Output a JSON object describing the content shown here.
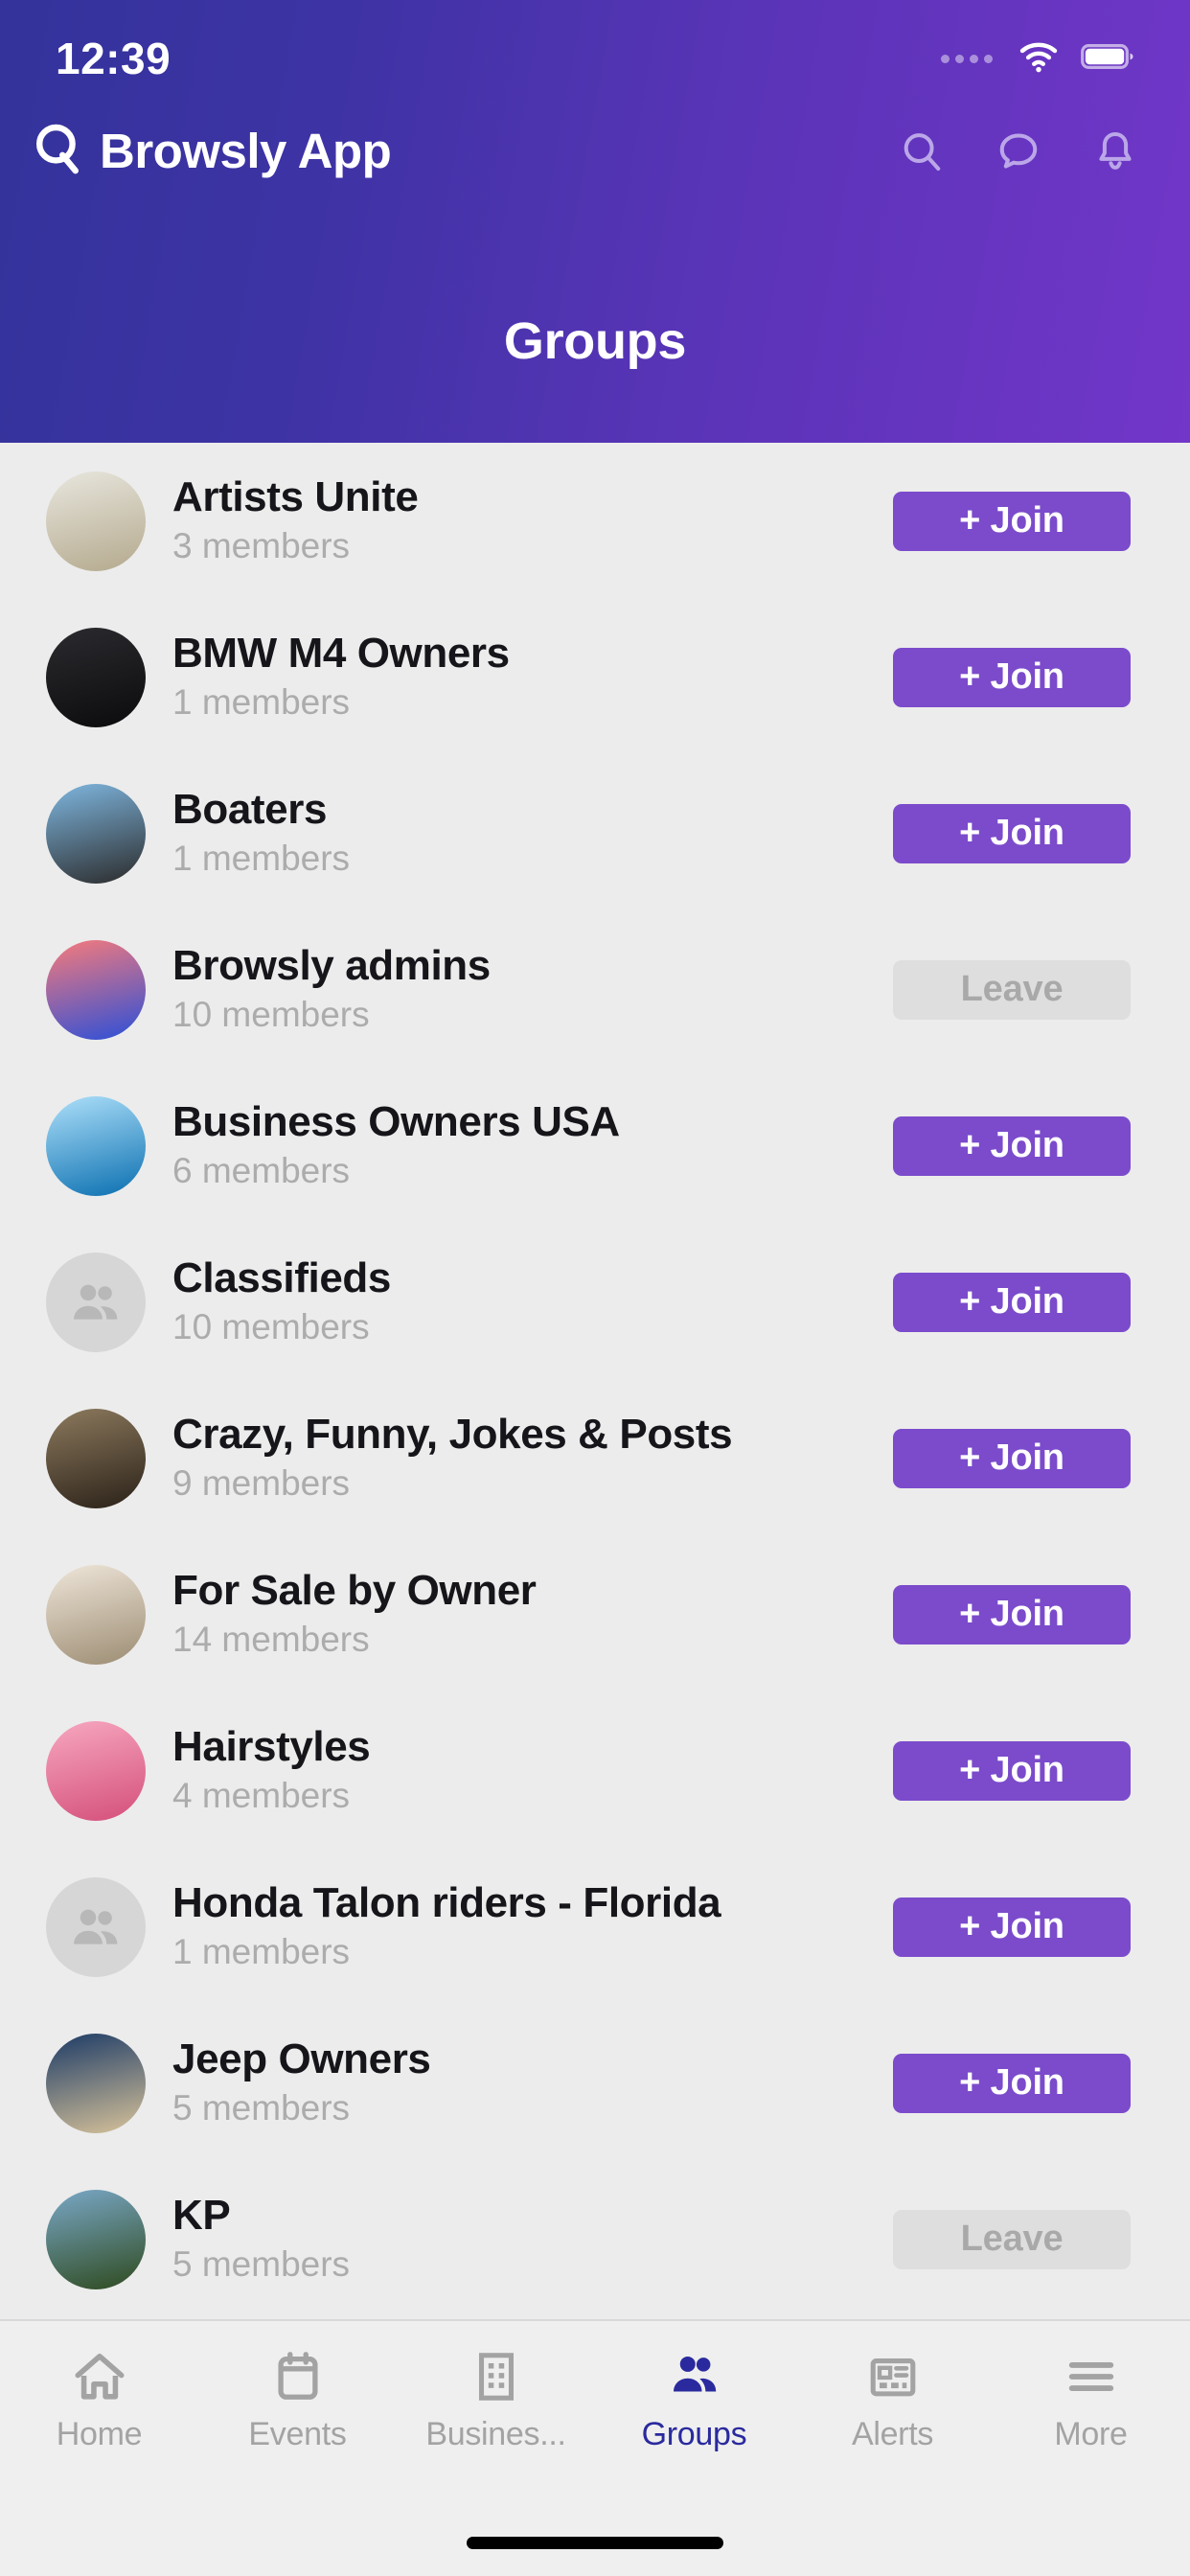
{
  "status_bar": {
    "time": "12:39",
    "signal_icon": "signal-dots-icon",
    "wifi_icon": "wifi-icon",
    "battery_icon": "battery-full-icon"
  },
  "header": {
    "brand_logo_icon": "browsly-q-logo-icon",
    "brand_name": "Browsly App",
    "page_title": "Groups",
    "actions": [
      {
        "name": "search-icon",
        "label": "Search"
      },
      {
        "name": "messages-icon",
        "label": "Messages"
      },
      {
        "name": "notifications-bell-icon",
        "label": "Notifications"
      }
    ]
  },
  "groups": [
    {
      "name": "Artists Unite",
      "members": "3 members",
      "action": "+ Join",
      "state": "join",
      "avatar": "art-collage-photo",
      "avatar_type": "photo",
      "colors": [
        "#e8e6de",
        "#b4a98d"
      ]
    },
    {
      "name": "BMW M4 Owners",
      "members": "1 members",
      "action": "+ Join",
      "state": "join",
      "avatar": "black-bmw-car-photo",
      "avatar_type": "photo",
      "colors": [
        "#2b2b2f",
        "#0b0b0d"
      ]
    },
    {
      "name": "Boaters",
      "members": "1 members",
      "action": "+ Join",
      "state": "join",
      "avatar": "yacht-boat-photo",
      "avatar_type": "photo",
      "colors": [
        "#7fb7e0",
        "#2b2b2b"
      ]
    },
    {
      "name": "Browsly admins",
      "members": "10 members",
      "action": "Leave",
      "state": "leave",
      "avatar": "pink-blue-gradient",
      "avatar_type": "gradient",
      "colors": [
        "#f87b7b",
        "#2b4fd8"
      ]
    },
    {
      "name": "Business Owners USA",
      "members": "6 members",
      "action": "+ Join",
      "state": "join",
      "avatar": "businessmen-walk-photo",
      "avatar_type": "photo",
      "colors": [
        "#aee0fa",
        "#0a6fb0"
      ]
    },
    {
      "name": "Classifieds",
      "members": "10 members",
      "action": "+ Join",
      "state": "join",
      "avatar": "people-placeholder",
      "avatar_type": "placeholder",
      "colors": [
        "#d6d6d6",
        "#d6d6d6"
      ]
    },
    {
      "name": "Crazy,  Funny,  Jokes & Posts",
      "members": "9 members",
      "action": "+ Join",
      "state": "join",
      "avatar": "biker-costume-photo",
      "avatar_type": "photo",
      "colors": [
        "#8d7a5e",
        "#2a2118"
      ]
    },
    {
      "name": "For Sale by Owner",
      "members": "14 members",
      "action": "+ Join",
      "state": "join",
      "avatar": "couple-moving-photo",
      "avatar_type": "photo",
      "colors": [
        "#efe6da",
        "#9c8c72"
      ]
    },
    {
      "name": "Hairstyles",
      "members": "4 members",
      "action": "+ Join",
      "state": "join",
      "avatar": "women-hairstyle-photo",
      "avatar_type": "photo",
      "colors": [
        "#f7a8c0",
        "#d44f7a"
      ]
    },
    {
      "name": "Honda Talon riders - Florida",
      "members": "1 members",
      "action": "+ Join",
      "state": "join",
      "avatar": "people-placeholder",
      "avatar_type": "placeholder",
      "colors": [
        "#d6d6d6",
        "#d6d6d6"
      ]
    },
    {
      "name": "Jeep Owners",
      "members": "5 members",
      "action": "+ Join",
      "state": "join",
      "avatar": "jeep-offroad-photo",
      "avatar_type": "photo",
      "colors": [
        "#1b3a66",
        "#d8c39a"
      ]
    },
    {
      "name": "KP",
      "members": "5 members",
      "action": "Leave",
      "state": "leave",
      "avatar": "waterfall-cliff-photo",
      "avatar_type": "photo",
      "colors": [
        "#7aa8c8",
        "#2e4a1e"
      ]
    }
  ],
  "tabs": [
    {
      "label": "Home",
      "icon": "home-icon",
      "active": false
    },
    {
      "label": "Events",
      "icon": "calendar-icon",
      "active": false
    },
    {
      "label": "Busines...",
      "icon": "building-icon",
      "active": false
    },
    {
      "label": "Groups",
      "icon": "people-icon",
      "active": true
    },
    {
      "label": "Alerts",
      "icon": "newspaper-icon",
      "active": false
    },
    {
      "label": "More",
      "icon": "menu-icon",
      "active": false
    }
  ],
  "colors": {
    "header_gradient_start": "#33339B",
    "header_gradient_end": "#7236C9",
    "join_button": "#7B4BCB",
    "leave_button_bg": "#DEDEDE",
    "leave_button_text": "#A9A9A9",
    "active_tab": "#2A2A9E",
    "background": "#ECECEC"
  }
}
